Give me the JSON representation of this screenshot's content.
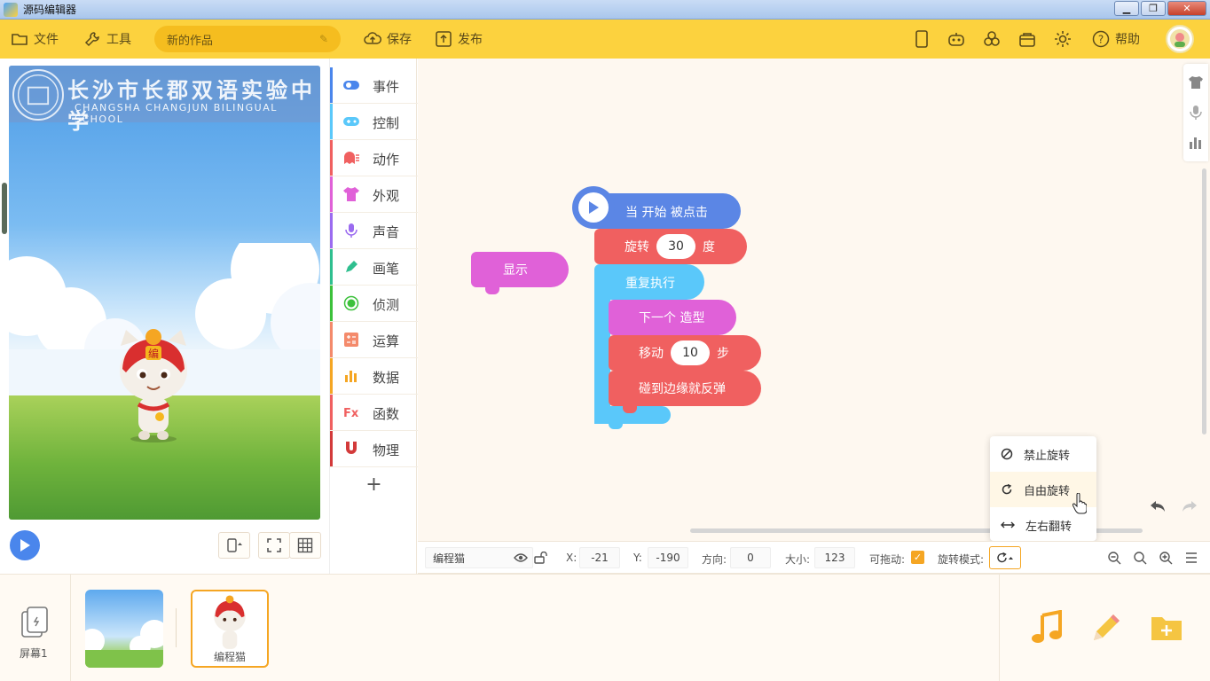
{
  "window": {
    "title": "源码编辑器",
    "minimize": "▁",
    "maximize": "❐",
    "close": "✕"
  },
  "toolbar": {
    "file_label": "文件",
    "tools_label": "工具",
    "project_name": "新的作品",
    "save_label": "保存",
    "publish_label": "发布",
    "help_label": "帮助"
  },
  "stage": {
    "banner_title": "长沙市长郡双语实验中学",
    "banner_subtitle": "CHANGSHA CHANGJUN BILINGUAL SCHOOL"
  },
  "categories": [
    {
      "label": "事件",
      "color": "#4a86ec"
    },
    {
      "label": "控制",
      "color": "#5ac8fa"
    },
    {
      "label": "动作",
      "color": "#f06060"
    },
    {
      "label": "外观",
      "color": "#e061d8"
    },
    {
      "label": "声音",
      "color": "#9b6bf0"
    },
    {
      "label": "画笔",
      "color": "#2fbf8f"
    },
    {
      "label": "侦测",
      "color": "#3cc13b"
    },
    {
      "label": "运算",
      "color": "#f48a6b"
    },
    {
      "label": "数据",
      "color": "#f5a623"
    },
    {
      "label": "函数",
      "color": "#f06060"
    },
    {
      "label": "物理",
      "color": "#d33a3a"
    }
  ],
  "add_category": "+",
  "blocks": {
    "show": "显示",
    "when_start": "当 开始 被点击",
    "rotate_label": "旋转",
    "rotate_value": "30",
    "rotate_unit": "度",
    "repeat": "重复执行",
    "next_costume": "下一个 造型",
    "move_label": "移动",
    "move_value": "10",
    "move_unit": "步",
    "bounce": "碰到边缘就反弹"
  },
  "rotation_menu": {
    "no_rotate": "禁止旋转",
    "free_rotate": "自由旋转",
    "flip_lr": "左右翻转"
  },
  "props": {
    "sprite_name": "编程猫",
    "x_label": "X:",
    "x_value": "-21",
    "y_label": "Y:",
    "y_value": "-190",
    "dir_label": "方向:",
    "dir_value": "0",
    "size_label": "大小:",
    "size_value": "123",
    "drag_label": "可拖动:",
    "rotmode_label": "旋转模式:"
  },
  "bottom": {
    "screen_label": "屏幕1",
    "sprite_label": "编程猫"
  },
  "colors": {
    "toolbar": "#fcd23e",
    "accent": "#f5a623",
    "event_blue": "#5b86e5",
    "motion_red": "#f06060",
    "control_cyan": "#5ac8fa",
    "looks_pink": "#e061d8"
  }
}
